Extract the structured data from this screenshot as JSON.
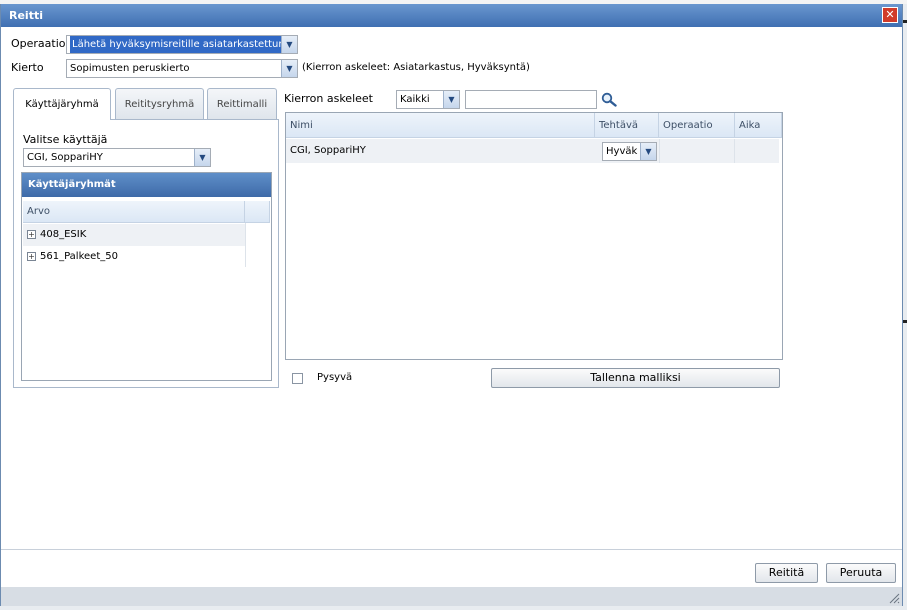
{
  "dialog": {
    "title": "Reitti",
    "close_symbol": "✕"
  },
  "form": {
    "operaatio_label": "Operaatio",
    "operaatio_value": "Lähetä hyväksymisreitille asiatarkastettuna",
    "kierto_label": "Kierto",
    "kierto_value": "Sopimusten peruskierto",
    "kierto_info": "(Kierron askeleet: Asiatarkastus, Hyväksyntä)"
  },
  "tabs": [
    {
      "label": "Käyttäjäryhmä",
      "active": true
    },
    {
      "label": "Reititysryhmä",
      "active": false
    },
    {
      "label": "Reittimalli",
      "active": false
    }
  ],
  "user_panel": {
    "select_label": "Valitse käyttäjä",
    "selected_user": "CGI, SoppariHY",
    "groups_title": "Käyttäjäryhmät",
    "column_header": "Arvo",
    "groups": [
      "408_ESIK",
      "561_Palkeet_50"
    ],
    "expand_symbol": "+"
  },
  "steps_panel": {
    "label": "Kierron askeleet",
    "filter_value": "Kaikki",
    "search_value": "",
    "columns": [
      "Nimi",
      "Tehtävä",
      "Operaatio",
      "Aika"
    ],
    "rows": [
      {
        "nimi": "CGI, SoppariHY",
        "tehtava": "Hyväk",
        "operaatio": "",
        "aika": ""
      }
    ]
  },
  "options": {
    "pysyva_label": "Pysyvä",
    "pysyva_checked": false,
    "save_template_label": "Tallenna malliksi"
  },
  "footer": {
    "route_button": "Reititä",
    "cancel_button": "Peruuta"
  },
  "icons": {
    "dropdown": "chevron-down-icon",
    "search": "search-icon",
    "close": "close-icon",
    "expand": "plus-icon",
    "resize": "resize-grip-icon"
  },
  "colors": {
    "titlebar": "#3f6fb2",
    "panel_header": "#3e6aa8",
    "close_button": "#d13b2a",
    "selection": "#3169c6"
  }
}
